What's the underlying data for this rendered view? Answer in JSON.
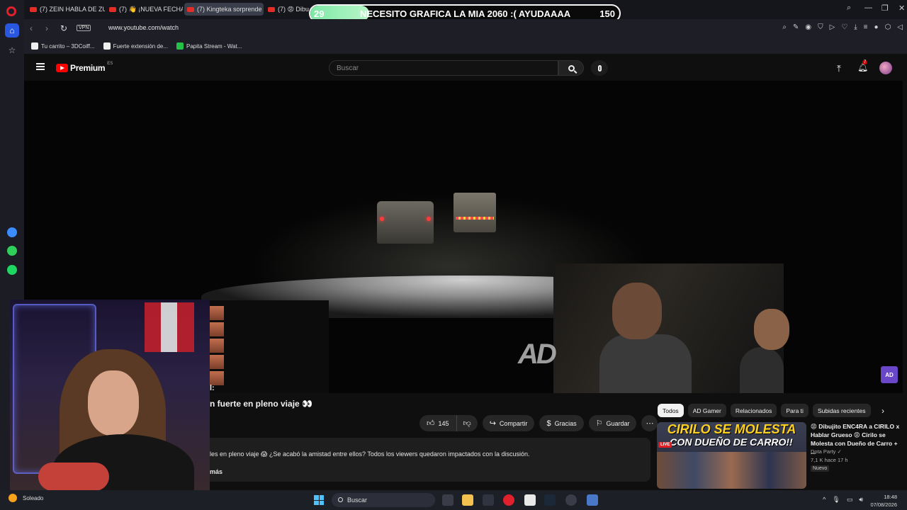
{
  "browser": {
    "tabs": [
      {
        "label": "(7) ZEIN HABLA DE ZULLY"
      },
      {
        "label": "(7) 👋 ¡NUEVA FECHA para"
      },
      {
        "label": "(7) Kingteka sorprende"
      },
      {
        "label": "(7) 😡 Dibujito"
      }
    ],
    "url": "www.youtube.com/watch",
    "vpn_label": "VPN",
    "bookmarks": [
      {
        "label": "Tu carrito – 3DCoiff..."
      },
      {
        "label": "Fuerte extensión de..."
      },
      {
        "label": "Papita Stream - Wat..."
      }
    ]
  },
  "stream_overlay": {
    "left_number": "29",
    "message": "NECESITO GRAFICA LA MIA 2060 :( AYUDAAAA",
    "right_number": "150",
    "progress_fraction": 0.19
  },
  "youtube": {
    "logo_word": "Premium",
    "logo_region": "ES",
    "search_placeholder": "Buscar",
    "notification_count": "7",
    "video": {
      "watermark": "AD",
      "title_partial": "n fuerte en pleno viaje 👀",
      "likes": "145",
      "share_label": "Compartir",
      "thanks_label": "Gracias",
      "save_label": "Guardar",
      "description": "les en pleno viaje 😱 ¿Se acabó la amistad entre ellos? Todos los viewers quedaron impactados con la discusión.",
      "more_label": "más",
      "side_label": "l:"
    },
    "chips": [
      {
        "label": "Todos",
        "selected": true
      },
      {
        "label": "AD Gamer"
      },
      {
        "label": "Relacionados"
      },
      {
        "label": "Para ti"
      },
      {
        "label": "Subidas recientes"
      }
    ],
    "recommendation": {
      "thumb_line1": "CIRILO SE MOLESTA",
      "thumb_line2": "CON DUEÑO DE CARRO!!",
      "thumb_live": "LIVE",
      "title": "😡 Dibujito ENC4RA a CIRILO x Hablar Grueso 😡 Cirilo se Molesta con Dueño de Carro + ...",
      "channel": "Dota Party ✓",
      "meta": "7,1 K  hace 17 h",
      "badge": "Nuevo"
    }
  },
  "taskbar": {
    "weather": "Soleado",
    "search_placeholder": "Buscar",
    "time": "18:48",
    "date": "07/08/2026"
  },
  "colors": {
    "youtube_red": "#ff0000",
    "opera_red": "#e0212c",
    "overlay_green": "#7ee8a6",
    "windows_blue": "#4cc2ff"
  }
}
